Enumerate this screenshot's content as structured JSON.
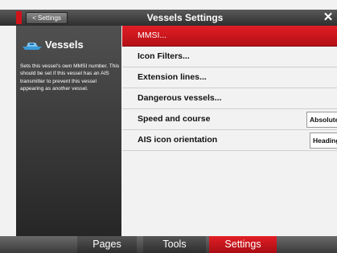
{
  "titlebar": {
    "back_label": "< Settings",
    "title": "Vessels Settings",
    "close_glyph": "✕"
  },
  "left_panel": {
    "title": "Vessels",
    "icon": "vessel-icon",
    "description": "Sets this vessel's own MMSI number. This should be set if this vessel has an AIS transmitter to prevent this vessel appearing as another vessel."
  },
  "menu": {
    "items": [
      {
        "label": "MMSI...",
        "selected": true
      },
      {
        "label": "Icon Filters..."
      },
      {
        "label": "Extension lines..."
      },
      {
        "label": "Dangerous vessels..."
      },
      {
        "label": "Speed and course",
        "value": "Absolute"
      },
      {
        "label": "AIS icon orientation",
        "value": "Heading"
      }
    ]
  },
  "bottombar": {
    "pages_label": "Pages",
    "tools_label": "Tools",
    "settings_label": "Settings"
  },
  "colors": {
    "accent_red": "#d0121a",
    "panel_dark": "#333333",
    "menu_bg": "#f2f2f2"
  }
}
